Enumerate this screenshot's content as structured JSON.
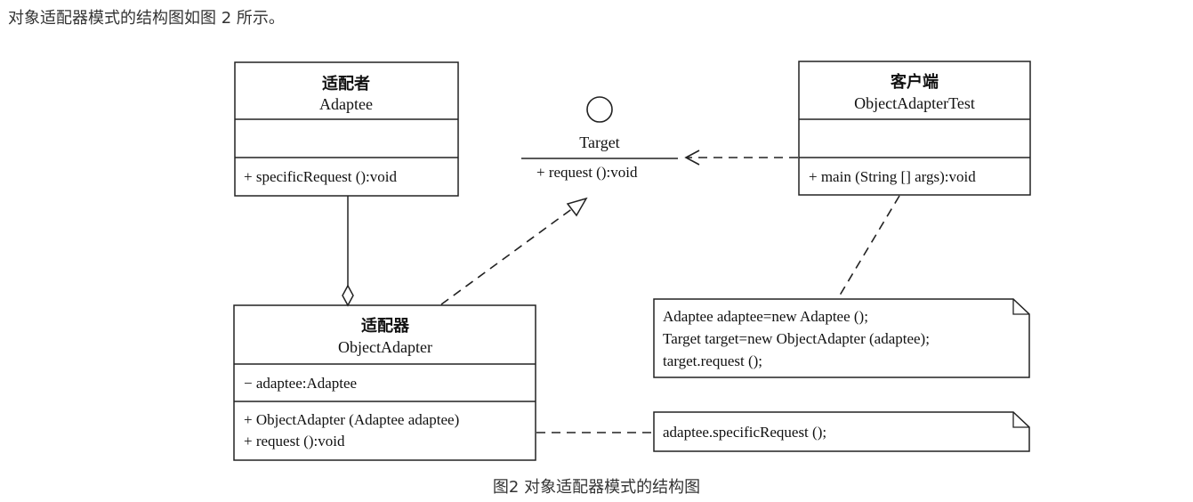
{
  "intro_text": "对象适配器模式的结构图如图 2 所示。",
  "caption": "图2 对象适配器模式的结构图",
  "adaptee": {
    "title_cn": "适配者",
    "title_en": "Adaptee",
    "operation": "+ specificRequest ():void"
  },
  "target": {
    "name": "Target",
    "operation": "+ request ():void"
  },
  "client": {
    "title_cn": "客户端",
    "title_en": "ObjectAdapterTest",
    "operation": "+ main (String [] args):void"
  },
  "adapter": {
    "title_cn": "适配器",
    "title_en": "ObjectAdapter",
    "attribute": "− adaptee:Adaptee",
    "operations": [
      "+ ObjectAdapter (Adaptee adaptee)",
      "+ request ():void"
    ]
  },
  "client_note": {
    "lines": [
      "Adaptee adaptee=new Adaptee ();",
      "Target target=new ObjectAdapter (adaptee);",
      "target.request ();"
    ]
  },
  "adapter_note": {
    "lines": [
      "adaptee.specificRequest ();"
    ]
  }
}
